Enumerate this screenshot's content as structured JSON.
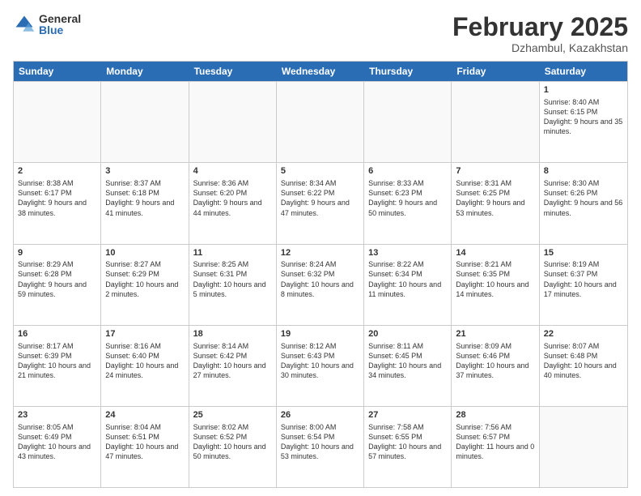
{
  "logo": {
    "general": "General",
    "blue": "Blue"
  },
  "title": "February 2025",
  "location": "Dzhambul, Kazakhstan",
  "days": [
    "Sunday",
    "Monday",
    "Tuesday",
    "Wednesday",
    "Thursday",
    "Friday",
    "Saturday"
  ],
  "rows": [
    [
      {
        "day": "",
        "info": ""
      },
      {
        "day": "",
        "info": ""
      },
      {
        "day": "",
        "info": ""
      },
      {
        "day": "",
        "info": ""
      },
      {
        "day": "",
        "info": ""
      },
      {
        "day": "",
        "info": ""
      },
      {
        "day": "1",
        "info": "Sunrise: 8:40 AM\nSunset: 6:15 PM\nDaylight: 9 hours and 35 minutes."
      }
    ],
    [
      {
        "day": "2",
        "info": "Sunrise: 8:38 AM\nSunset: 6:17 PM\nDaylight: 9 hours and 38 minutes."
      },
      {
        "day": "3",
        "info": "Sunrise: 8:37 AM\nSunset: 6:18 PM\nDaylight: 9 hours and 41 minutes."
      },
      {
        "day": "4",
        "info": "Sunrise: 8:36 AM\nSunset: 6:20 PM\nDaylight: 9 hours and 44 minutes."
      },
      {
        "day": "5",
        "info": "Sunrise: 8:34 AM\nSunset: 6:22 PM\nDaylight: 9 hours and 47 minutes."
      },
      {
        "day": "6",
        "info": "Sunrise: 8:33 AM\nSunset: 6:23 PM\nDaylight: 9 hours and 50 minutes."
      },
      {
        "day": "7",
        "info": "Sunrise: 8:31 AM\nSunset: 6:25 PM\nDaylight: 9 hours and 53 minutes."
      },
      {
        "day": "8",
        "info": "Sunrise: 8:30 AM\nSunset: 6:26 PM\nDaylight: 9 hours and 56 minutes."
      }
    ],
    [
      {
        "day": "9",
        "info": "Sunrise: 8:29 AM\nSunset: 6:28 PM\nDaylight: 9 hours and 59 minutes."
      },
      {
        "day": "10",
        "info": "Sunrise: 8:27 AM\nSunset: 6:29 PM\nDaylight: 10 hours and 2 minutes."
      },
      {
        "day": "11",
        "info": "Sunrise: 8:25 AM\nSunset: 6:31 PM\nDaylight: 10 hours and 5 minutes."
      },
      {
        "day": "12",
        "info": "Sunrise: 8:24 AM\nSunset: 6:32 PM\nDaylight: 10 hours and 8 minutes."
      },
      {
        "day": "13",
        "info": "Sunrise: 8:22 AM\nSunset: 6:34 PM\nDaylight: 10 hours and 11 minutes."
      },
      {
        "day": "14",
        "info": "Sunrise: 8:21 AM\nSunset: 6:35 PM\nDaylight: 10 hours and 14 minutes."
      },
      {
        "day": "15",
        "info": "Sunrise: 8:19 AM\nSunset: 6:37 PM\nDaylight: 10 hours and 17 minutes."
      }
    ],
    [
      {
        "day": "16",
        "info": "Sunrise: 8:17 AM\nSunset: 6:39 PM\nDaylight: 10 hours and 21 minutes."
      },
      {
        "day": "17",
        "info": "Sunrise: 8:16 AM\nSunset: 6:40 PM\nDaylight: 10 hours and 24 minutes."
      },
      {
        "day": "18",
        "info": "Sunrise: 8:14 AM\nSunset: 6:42 PM\nDaylight: 10 hours and 27 minutes."
      },
      {
        "day": "19",
        "info": "Sunrise: 8:12 AM\nSunset: 6:43 PM\nDaylight: 10 hours and 30 minutes."
      },
      {
        "day": "20",
        "info": "Sunrise: 8:11 AM\nSunset: 6:45 PM\nDaylight: 10 hours and 34 minutes."
      },
      {
        "day": "21",
        "info": "Sunrise: 8:09 AM\nSunset: 6:46 PM\nDaylight: 10 hours and 37 minutes."
      },
      {
        "day": "22",
        "info": "Sunrise: 8:07 AM\nSunset: 6:48 PM\nDaylight: 10 hours and 40 minutes."
      }
    ],
    [
      {
        "day": "23",
        "info": "Sunrise: 8:05 AM\nSunset: 6:49 PM\nDaylight: 10 hours and 43 minutes."
      },
      {
        "day": "24",
        "info": "Sunrise: 8:04 AM\nSunset: 6:51 PM\nDaylight: 10 hours and 47 minutes."
      },
      {
        "day": "25",
        "info": "Sunrise: 8:02 AM\nSunset: 6:52 PM\nDaylight: 10 hours and 50 minutes."
      },
      {
        "day": "26",
        "info": "Sunrise: 8:00 AM\nSunset: 6:54 PM\nDaylight: 10 hours and 53 minutes."
      },
      {
        "day": "27",
        "info": "Sunrise: 7:58 AM\nSunset: 6:55 PM\nDaylight: 10 hours and 57 minutes."
      },
      {
        "day": "28",
        "info": "Sunrise: 7:56 AM\nSunset: 6:57 PM\nDaylight: 11 hours and 0 minutes."
      },
      {
        "day": "",
        "info": ""
      }
    ]
  ]
}
